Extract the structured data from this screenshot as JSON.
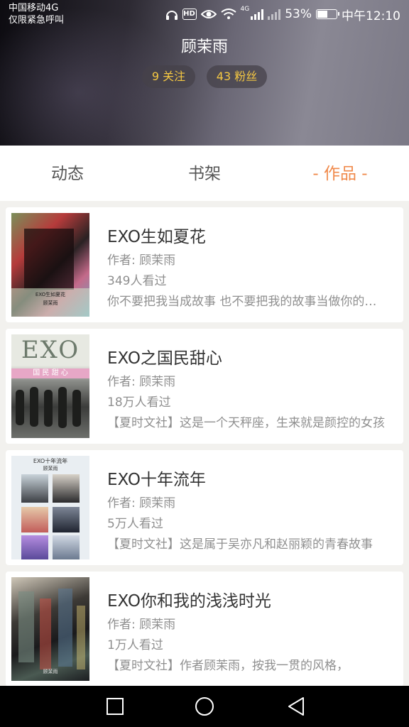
{
  "status_bar": {
    "carrier": "中国移动4G",
    "emergency": "仅限紧急呼叫",
    "hd_badge": "HD",
    "net_label": "4G",
    "battery": "53%",
    "time": "中午12:10"
  },
  "profile": {
    "name": "顾茉雨",
    "following": "9 关注",
    "followers": "43 粉丝"
  },
  "tabs": [
    {
      "label": "动态"
    },
    {
      "label": "书架"
    },
    {
      "label": "- 作品 -"
    }
  ],
  "active_tab_color": "#f08a4b",
  "books": [
    {
      "title": "EXO生如夏花",
      "author": "作者: 顾茉雨",
      "views": "349人看过",
      "desc": "你不要把我当成故事 也不要把我的故事当做你的故事",
      "cover_text": [
        "EXO生如夏花",
        "顾茉雨"
      ]
    },
    {
      "title": "EXO之国民甜心",
      "author": "作者: 顾茉雨",
      "views": "18万人看过",
      "desc": "【夏时文社】这是一个天秤座，生来就是颜控的女孩",
      "cover_text": [
        "EXO",
        "国 民 甜 心"
      ]
    },
    {
      "title": "EXO十年流年",
      "author": "作者: 顾茉雨",
      "views": "5万人看过",
      "desc": "【夏时文社】这是属于吴亦凡和赵丽颖的青春故事",
      "cover_text": [
        "EXO十年流年",
        "顾茉雨"
      ]
    },
    {
      "title": "EXO你和我的浅浅时光",
      "author": "作者: 顾茉雨",
      "views": "1万人看过",
      "desc": "【夏时文社】作者顾茉雨，按我一贯的风格，",
      "cover_text": [
        "顾茉雨"
      ]
    }
  ]
}
